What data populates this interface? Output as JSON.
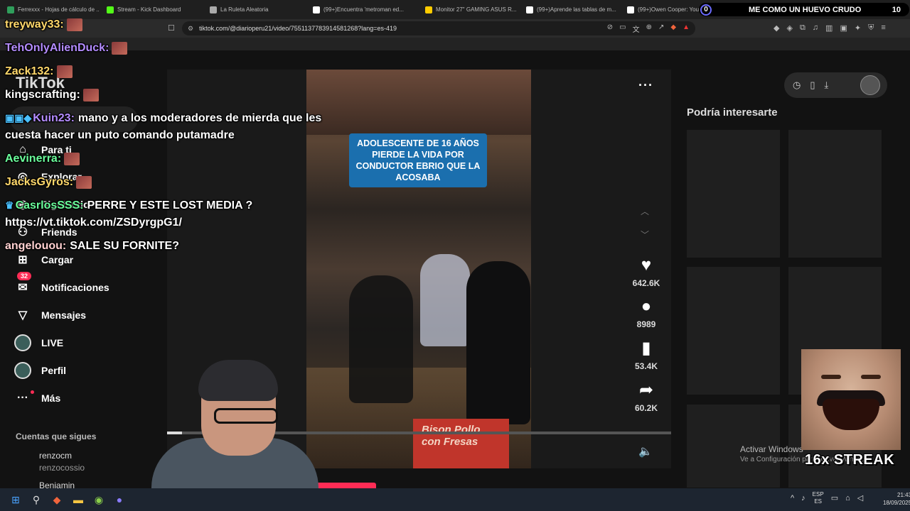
{
  "browser": {
    "tabs": [
      {
        "label": "Ferrexxx - Hojas de cálculo de ...",
        "color": "#2f9e5b"
      },
      {
        "label": "Stream - Kick Dashboard",
        "color": "#53fc18"
      },
      {
        "label": "La Ruleta Aleatoria",
        "color": "#aaaaaa"
      },
      {
        "label": "(99+)Encuentra 'metroman ed...",
        "color": "#ffffff"
      },
      {
        "label": "Monitor 27\" GAMING ASUS R...",
        "color": "#ffcc00"
      },
      {
        "label": "(99+)Aprende las tablas de m...",
        "color": "#ffffff"
      },
      {
        "label": "(99+)Owen Cooper: Younger...",
        "color": "#ffffff"
      }
    ],
    "url": "tiktok.com/@diarioperu21/video/7551137783914581268?lang=es-419"
  },
  "stream_overlay": {
    "counter_left": "0",
    "title": "ME COMO UN HUEVO CRUDO",
    "counter_right": "10",
    "streak_label": "16x STREAK"
  },
  "chat": [
    {
      "user": "treyway33:",
      "color": "#ffd86b",
      "msg": "",
      "emote": true
    },
    {
      "user": "TehOnlyAlienDuck:",
      "color": "#b48cff",
      "msg": "",
      "emote": true
    },
    {
      "user": "Zack132:",
      "color": "#ffd86b",
      "msg": "",
      "emote": true
    },
    {
      "user": "kingscrafting:",
      "color": "#ffffff",
      "msg": "",
      "emote": true
    },
    {
      "user": "Kuin23:",
      "color": "#b48cff",
      "msg": "mano y a los moderadores de mierda que les",
      "badges": "▣▣◆",
      "cont": "cuesta hacer un puto comando putamadre"
    },
    {
      "user": "Aevinerra:",
      "color": "#6bff9c",
      "msg": "",
      "emote": true
    },
    {
      "user": "JacksGyros:",
      "color": "#ffd86b",
      "msg": "",
      "emote": true
    },
    {
      "user": "CasrlosSSS:",
      "color": "#6bff9c",
      "msg": "PERRE Y ESTE LOST MEDIA ?",
      "badges": "♛",
      "cont": "https://vt.tiktok.com/ZSDyrgpG1/"
    },
    {
      "user": "angelouou:",
      "color": "#ffd0d0",
      "msg": "SALE SU FORNITE?"
    }
  ],
  "tiktok": {
    "logo": "TikTok",
    "nav": [
      {
        "label": "Para ti",
        "icon": "home-icon",
        "glyph": "⌂"
      },
      {
        "label": "Explorar",
        "icon": "compass-icon",
        "glyph": "◎"
      },
      {
        "label": "Siguiendo",
        "icon": "following-icon",
        "glyph": "◉"
      },
      {
        "label": "Friends",
        "icon": "friends-icon",
        "glyph": "⚇"
      },
      {
        "label": "Cargar",
        "icon": "upload-icon",
        "glyph": "⊞"
      },
      {
        "label": "Notificaciones",
        "icon": "notifications-icon",
        "glyph": "✉",
        "badge": "32"
      },
      {
        "label": "Mensajes",
        "icon": "messages-icon",
        "glyph": "▽"
      },
      {
        "label": "LIVE",
        "icon": "live-icon",
        "glyph": ""
      },
      {
        "label": "Perfil",
        "icon": "profile-icon",
        "glyph": ""
      },
      {
        "label": "Más",
        "icon": "more-icon",
        "glyph": "···",
        "dot": true
      }
    ],
    "following_title": "Cuentas que sigues",
    "following": [
      {
        "name": "renzocm",
        "handle": "renzocossio"
      },
      {
        "name": "Benjamin",
        "handle": ""
      }
    ],
    "video_caption": "ADOLESCENTE DE 16 AÑOS PIERDE LA VIDA POR CONDUCTOR EBRIO QUE LA ACOSABA",
    "video_sign": "Bison Pollo con Fresas",
    "actions": [
      {
        "name": "like",
        "icon": "heart-icon",
        "glyph": "♥",
        "count": "642.6K"
      },
      {
        "name": "comment",
        "icon": "comment-icon",
        "glyph": "●",
        "count": "8989"
      },
      {
        "name": "save",
        "icon": "bookmark-icon",
        "glyph": "▮",
        "count": "53.4K"
      },
      {
        "name": "share",
        "icon": "share-icon",
        "glyph": "➦",
        "count": "60.2K"
      }
    ],
    "progress": 0.03,
    "suggest_title": "Podría interesarte"
  },
  "windows": {
    "activate_title": "Activar Windows",
    "activate_sub": "Ve a Configuración para activar Windows.",
    "lang_top": "ESP",
    "lang_bottom": "ES",
    "time": "21:43",
    "date": "18/09/2025"
  }
}
